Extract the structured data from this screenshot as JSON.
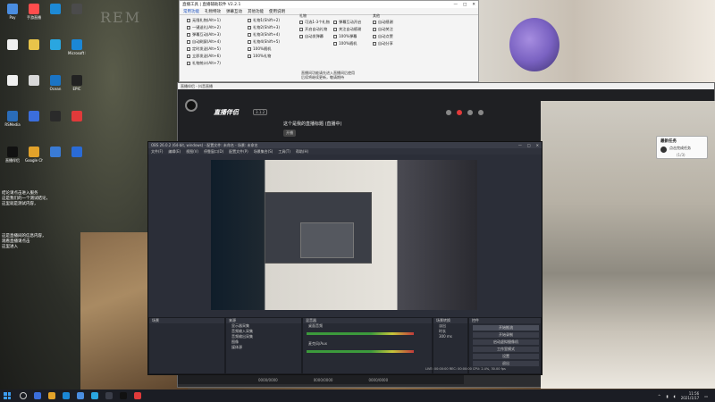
{
  "desktop": {
    "watermark": "REM",
    "icons": [
      {
        "label": "Pay",
        "color": "#4a8de0"
      },
      {
        "label": "",
        "color": "#f0f0f0"
      },
      {
        "label": "",
        "color": "#f0f0f0"
      },
      {
        "label": "RSMedia",
        "color": "#2a6cb8"
      },
      {
        "label": "直播伴侣",
        "color": "#111111"
      },
      {
        "label": "手游直播",
        "color": "#ff4d4d"
      },
      {
        "label": "",
        "color": "#e8c44a"
      },
      {
        "label": "",
        "color": "#d8d8d8"
      },
      {
        "label": "",
        "color": "#3b6edc"
      },
      {
        "label": "Google Chrome",
        "color": "#e2a22a"
      },
      {
        "label": "",
        "color": "#1d8ad6"
      },
      {
        "label": "",
        "color": "#2aa6e0"
      },
      {
        "label": "Ocean",
        "color": "#1a74c4"
      },
      {
        "label": "",
        "color": "#2a2a2a"
      },
      {
        "label": "",
        "color": "#3a7bd5"
      },
      {
        "label": "",
        "color": "#4b4b4b"
      },
      {
        "label": "Microsoft Edge",
        "color": "#1b87d6"
      },
      {
        "label": "EPIC",
        "color": "#222222"
      },
      {
        "label": "",
        "color": "#e03a3a"
      },
      {
        "label": "",
        "color": "#2a6bd6"
      }
    ],
    "note_lines": [
      "结论请点击进入服务",
      "这是我们的一个测试结论，",
      "这里就是测试内容，"
    ],
    "note2_lines": [
      "这是直播间的信息内容，",
      "观看直播请点击",
      "这里进入"
    ]
  },
  "util_window": {
    "title": "直播工具 | 直播辅助软件 V2.2.1",
    "controls": [
      "—",
      "□",
      "✕"
    ],
    "menu": [
      "常用功能",
      "礼物特效",
      "弹幕互动",
      "其他功能",
      "使用说明"
    ],
    "col1": [
      "无限礼物(Alt+1)",
      "一键送礼(Alt+2)",
      "弹幕互动(Alt+3)",
      "自动刷屏(Alt+4)",
      "定时发送(Alt+5)",
      "立即发送(Alt+6)",
      "礼物统计(Alt+7)"
    ],
    "col2": [
      "礼物1(Shift+2)",
      "礼物2(Shift+3)",
      "礼物3(Shift+4)",
      "礼物4(Shift+5)",
      "100%随机",
      "100%礼物"
    ],
    "col3_title": "礼物",
    "col3": [
      "可选1-3个礼物",
      "开启自动礼物",
      "自动发弹幕"
    ],
    "col4": [
      "弹幕互动开启",
      "关注自动感谢",
      "100%弹幕",
      "100%随机"
    ],
    "col5_title": "其他",
    "col5": [
      "自动感谢",
      "自动关注",
      "自动点赞",
      "自动分享"
    ],
    "footer_note": [
      "直播间功能请先进入直播间后使用",
      "后续将继续更新，敬请期待"
    ]
  },
  "live_app": {
    "title": "直播伴侣 - 抖音直播",
    "brand": "直播伴侣",
    "version": "3.1.2",
    "room_title": "这个是我的直播标题 (直播中)",
    "room_button": "开播"
  },
  "notification": {
    "title": "最新任务",
    "detail": "点击完成任务",
    "sub": "(1/3)"
  },
  "obs": {
    "title": "OBS 26.0.2 (64-bit, windows) - 配置文件: 未命名 - 场景: 未命名",
    "menu": [
      "文件(F)",
      "编辑(E)",
      "视图(V)",
      "停靠窗口(D)",
      "配置文件(P)",
      "场景集合(S)",
      "工具(T)",
      "帮助(H)"
    ],
    "docks": {
      "scenes": "场景",
      "sources": "来源",
      "mixer": "混音器",
      "transitions": "场景转换",
      "controls": "控件"
    },
    "sources": [
      "显示器采集",
      "音频输入采集",
      "音频输出采集",
      "图像",
      "媒体源"
    ],
    "mixer_tracks": [
      "桌面音频",
      "麦克风/Aux"
    ],
    "transition": "淡出",
    "duration_label": "时长",
    "duration_value": "300 ms",
    "controls": [
      "开始推流",
      "开始录制",
      "启动虚拟摄像机",
      "工作室模式",
      "设置",
      "退出"
    ],
    "status": "LIVE: 00:00:00  REC: 00:00:00  CPU: 2.4%, 30.00 fps"
  },
  "lower_bar": [
    "0000/0000",
    "0000/0000",
    "0000/0000"
  ],
  "taskbar": {
    "time": "11:56",
    "date": "2021/1/17"
  }
}
